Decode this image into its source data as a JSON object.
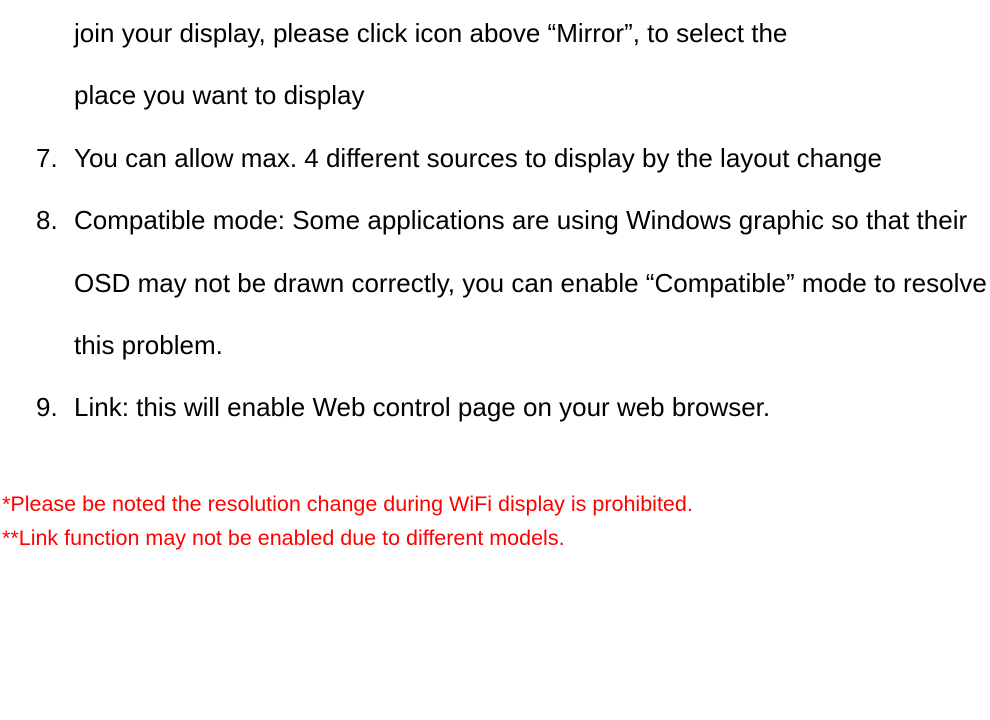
{
  "continuation_line1": "join your display, please click icon above “Mirror”, to select the",
  "continuation_line2": "place you want to display",
  "items": {
    "7": {
      "num": "7.",
      "text": "You can allow max. 4 different sources to display by the layout change"
    },
    "8": {
      "num": "8.",
      "text": "Compatible mode: Some applications are using Windows graphic so that their OSD may not be drawn correctly, you can enable “Compatible” mode to resolve this problem."
    },
    "9": {
      "num": "9.",
      "text": "Link: this will enable Web control page on your web browser."
    }
  },
  "notes": {
    "a": "*Please be noted the resolution change during WiFi display is prohibited.",
    "b": "**Link function may not be enabled due to different models."
  }
}
